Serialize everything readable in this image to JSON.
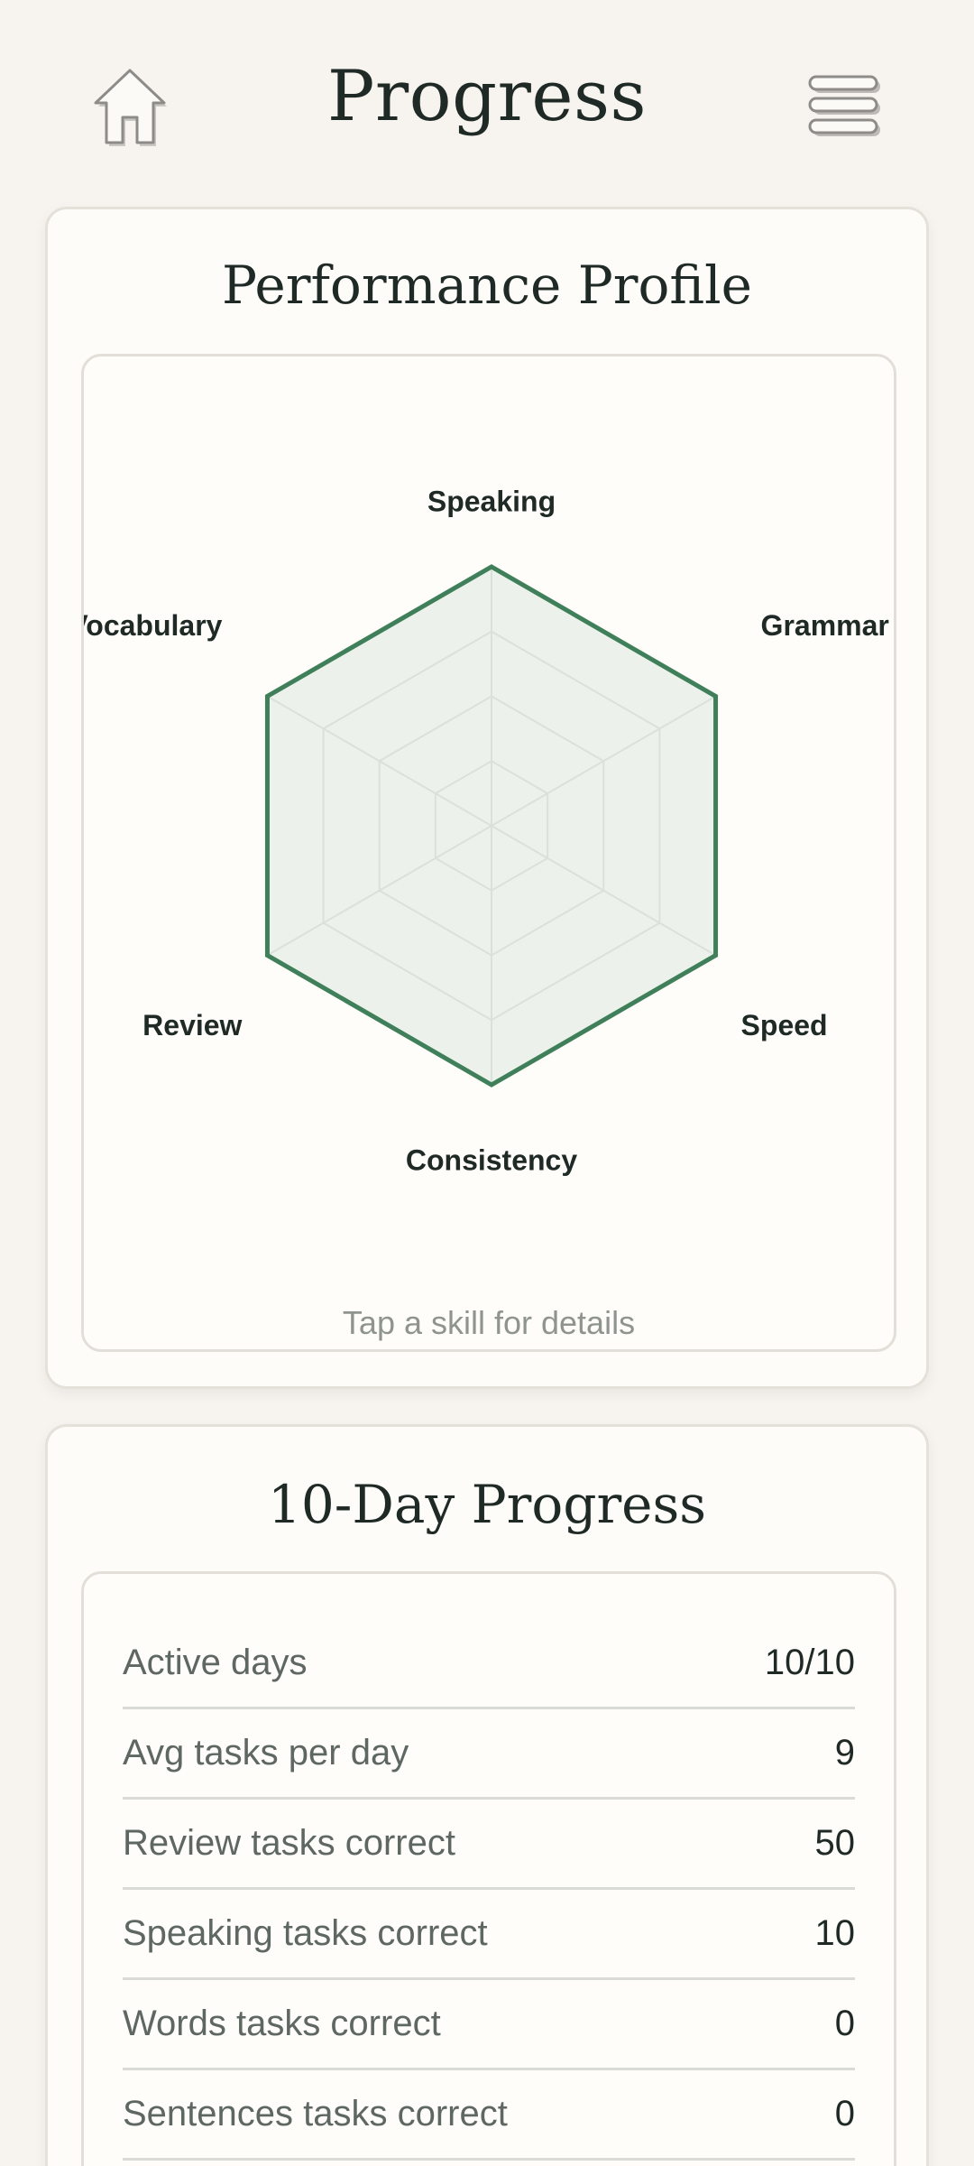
{
  "header": {
    "title": "Progress",
    "home_icon": "home-icon",
    "menu_icon": "menu-icon"
  },
  "profile": {
    "title": "Performance Profile",
    "hint": "Tap a skill for details",
    "axes": [
      "Speaking",
      "Grammar",
      "Speed",
      "Consistency",
      "Review",
      "Vocabulary"
    ],
    "scores": [
      1,
      1,
      1,
      1,
      1,
      1
    ],
    "grid_levels": 4,
    "colors": {
      "stroke": "#3f7f5a",
      "fill": "#e5ede5",
      "grid": "#b7bbb6"
    }
  },
  "progress": {
    "title": "10-Day Progress",
    "rows": [
      {
        "label": "Active days",
        "value": "10/10"
      },
      {
        "label": "Avg tasks per day",
        "value": "9"
      },
      {
        "label": "Review tasks correct",
        "value": "50"
      },
      {
        "label": "Speaking tasks correct",
        "value": "10"
      },
      {
        "label": "Words tasks correct",
        "value": "0"
      },
      {
        "label": "Sentences tasks correct",
        "value": "0"
      }
    ]
  }
}
